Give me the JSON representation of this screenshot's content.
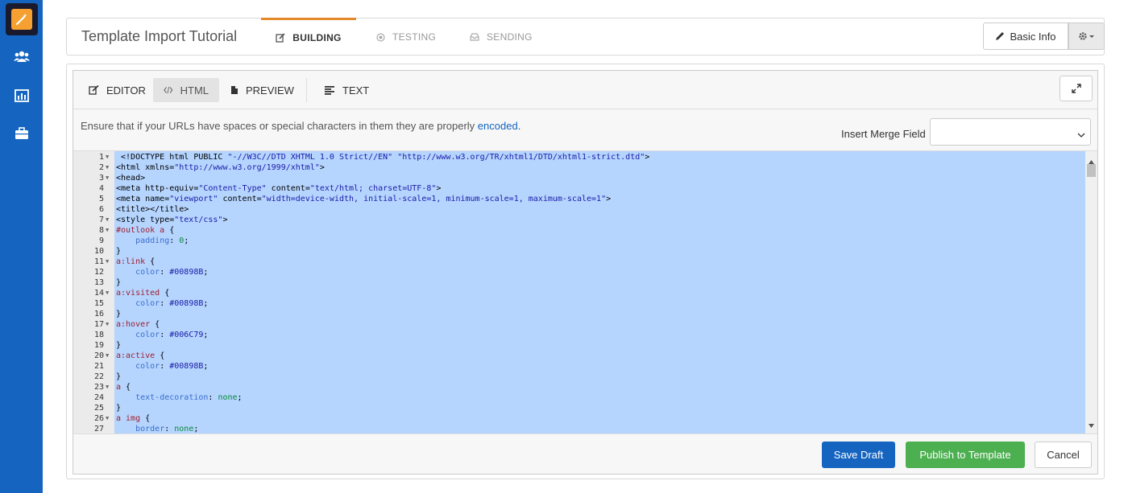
{
  "header": {
    "template_title": "Template Import Tutorial",
    "steps": [
      {
        "label": "BUILDING",
        "active": true
      },
      {
        "label": "TESTING",
        "active": false
      },
      {
        "label": "SENDING",
        "active": false
      }
    ],
    "basic_info_label": "Basic Info"
  },
  "modes": [
    {
      "label": "EDITOR",
      "icon": "edit-icon"
    },
    {
      "label": "HTML",
      "icon": "code-icon",
      "active": true
    },
    {
      "label": "PREVIEW",
      "icon": "file-icon"
    },
    {
      "label": "TEXT",
      "icon": "align-left-icon"
    }
  ],
  "info": {
    "message": "Ensure that if your URLs have spaces or special characters in them they are properly ",
    "link_text": "encoded",
    "message_end": ".",
    "merge_field_label": "Insert Merge Field",
    "merge_field_value": ""
  },
  "code_lines": [
    {
      "n": "1",
      "fold": true,
      "text": " <!DOCTYPE html PUBLIC \"-//W3C//DTD XHTML 1.0 Strict//EN\" \"http://www.w3.org/TR/xhtml1/DTD/xhtml1-strict.dtd\">"
    },
    {
      "n": "2",
      "fold": true,
      "text": "<html xmlns=\"http://www.w3.org/1999/xhtml\">"
    },
    {
      "n": "3",
      "fold": true,
      "text": "<head>"
    },
    {
      "n": "4",
      "fold": false,
      "text": "<meta http-equiv=\"Content-Type\" content=\"text/html; charset=UTF-8\">"
    },
    {
      "n": "5",
      "fold": false,
      "text": "<meta name=\"viewport\" content=\"width=device-width, initial-scale=1, minimum-scale=1, maximum-scale=1\">"
    },
    {
      "n": "6",
      "fold": false,
      "text": "<title></title>"
    },
    {
      "n": "7",
      "fold": true,
      "text": "<style type=\"text/css\">"
    },
    {
      "n": "8",
      "fold": true,
      "text": "#outlook a {"
    },
    {
      "n": "9",
      "fold": false,
      "text": "    padding: 0;"
    },
    {
      "n": "10",
      "fold": false,
      "text": "}"
    },
    {
      "n": "11",
      "fold": true,
      "text": "a:link {"
    },
    {
      "n": "12",
      "fold": false,
      "text": "    color: #00898B;"
    },
    {
      "n": "13",
      "fold": false,
      "text": "}"
    },
    {
      "n": "14",
      "fold": true,
      "text": "a:visited {"
    },
    {
      "n": "15",
      "fold": false,
      "text": "    color: #00898B;"
    },
    {
      "n": "16",
      "fold": false,
      "text": "}"
    },
    {
      "n": "17",
      "fold": true,
      "text": "a:hover {"
    },
    {
      "n": "18",
      "fold": false,
      "text": "    color: #006C79;"
    },
    {
      "n": "19",
      "fold": false,
      "text": "}"
    },
    {
      "n": "20",
      "fold": true,
      "text": "a:active {"
    },
    {
      "n": "21",
      "fold": false,
      "text": "    color: #00898B;"
    },
    {
      "n": "22",
      "fold": false,
      "text": "}"
    },
    {
      "n": "23",
      "fold": true,
      "text": "a {"
    },
    {
      "n": "24",
      "fold": false,
      "text": "    text-decoration: none;"
    },
    {
      "n": "25",
      "fold": false,
      "text": "}"
    },
    {
      "n": "26",
      "fold": true,
      "text": "a img {"
    },
    {
      "n": "27",
      "fold": false,
      "text": "    border: none;"
    }
  ],
  "footer": {
    "save_label": "Save Draft",
    "publish_label": "Publish to Template",
    "cancel_label": "Cancel"
  },
  "colors": {
    "nav_bg": "#1565c0",
    "accent_orange": "#e58a2b",
    "save_blue": "#1565c0",
    "publish_green": "#4caf50",
    "selection": "#b5d5ff"
  }
}
